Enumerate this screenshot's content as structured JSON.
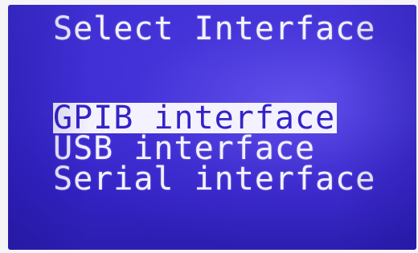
{
  "screen": {
    "title": "Select Interface"
  },
  "menu": {
    "items": [
      {
        "label": "GPIB interface",
        "selected": true
      },
      {
        "label": "USB interface",
        "selected": false
      },
      {
        "label": "Serial interface",
        "selected": false
      }
    ]
  },
  "colors": {
    "background": "#3a2ad2",
    "text": "#f4f2ff",
    "highlight_bg": "#f4f2ff",
    "highlight_text": "#3424c8"
  }
}
